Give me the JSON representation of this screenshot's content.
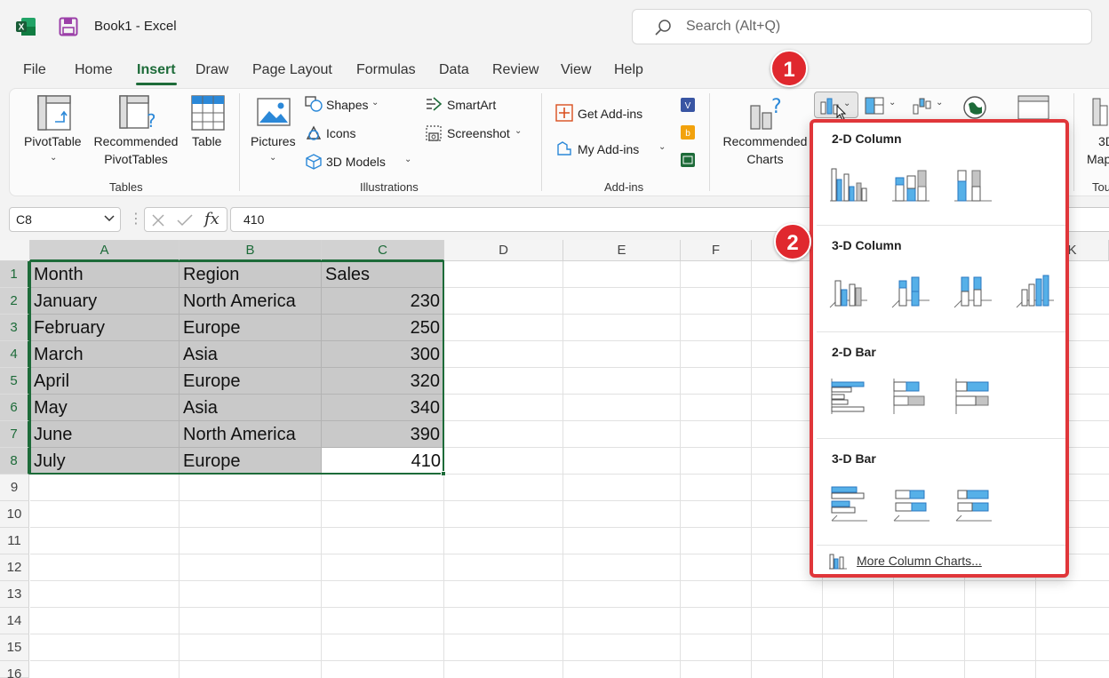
{
  "titlebar": {
    "doc_title": "Book1  -  Excel",
    "search_placeholder": "Search (Alt+Q)",
    "app_icon": "excel-logo-icon",
    "save_icon": "save-icon"
  },
  "tabs": [
    "File",
    "Home",
    "Insert",
    "Draw",
    "Page Layout",
    "Formulas",
    "Data",
    "Review",
    "View",
    "Help"
  ],
  "active_tab": "Insert",
  "ribbon": {
    "tables": {
      "group": "Tables",
      "pivot_table": "PivotTable",
      "recommended_pivot_line1": "Recommended",
      "recommended_pivot_line2": "PivotTables",
      "table": "Table"
    },
    "illustrations": {
      "group": "Illustrations",
      "pictures": "Pictures",
      "shapes": "Shapes",
      "icons": "Icons",
      "models": "3D Models",
      "smartart": "SmartArt",
      "screenshot": "Screenshot"
    },
    "addins": {
      "group": "Add-ins",
      "get": "Get Add-ins",
      "my": "My Add-ins"
    },
    "charts": {
      "recommended_line1": "Recommended",
      "recommended_line2": "Charts"
    },
    "partial_3d_line1": "3D",
    "partial_3d_line2": "Map",
    "partial_tours": "Tou"
  },
  "formula_bar": {
    "name_box": "C8",
    "value": "410",
    "fx": "fx"
  },
  "columns": [
    "A",
    "B",
    "C",
    "D",
    "E",
    "F",
    "",
    "K"
  ],
  "rows": [
    "1",
    "2",
    "3",
    "4",
    "5",
    "6",
    "7",
    "8",
    "9",
    "10",
    "11",
    "12",
    "13",
    "14",
    "15",
    "16"
  ],
  "sheet": {
    "header": [
      "Month",
      "Region",
      "Sales"
    ],
    "data": [
      [
        "January",
        "North America",
        "230"
      ],
      [
        "February",
        "Europe",
        "250"
      ],
      [
        "March",
        "Asia",
        "300"
      ],
      [
        "April",
        "Europe",
        "320"
      ],
      [
        "May",
        "Asia",
        "340"
      ],
      [
        "June",
        "North America",
        "390"
      ],
      [
        "July",
        "Europe",
        "410"
      ]
    ]
  },
  "callouts": [
    "1",
    "2"
  ],
  "dropdown": {
    "sections": [
      "2-D Column",
      "3-D Column",
      "2-D Bar",
      "3-D Bar"
    ],
    "more_link": "More Column Charts...",
    "colors": {
      "bar_blue": "#56b0e8",
      "bar_gray": "#c4c4c4",
      "outline": "#e0363a"
    }
  },
  "colors": {
    "accent_green": "#1d6b39",
    "selection_fill": "#c9c9c9",
    "callout_red": "#e0282e"
  }
}
